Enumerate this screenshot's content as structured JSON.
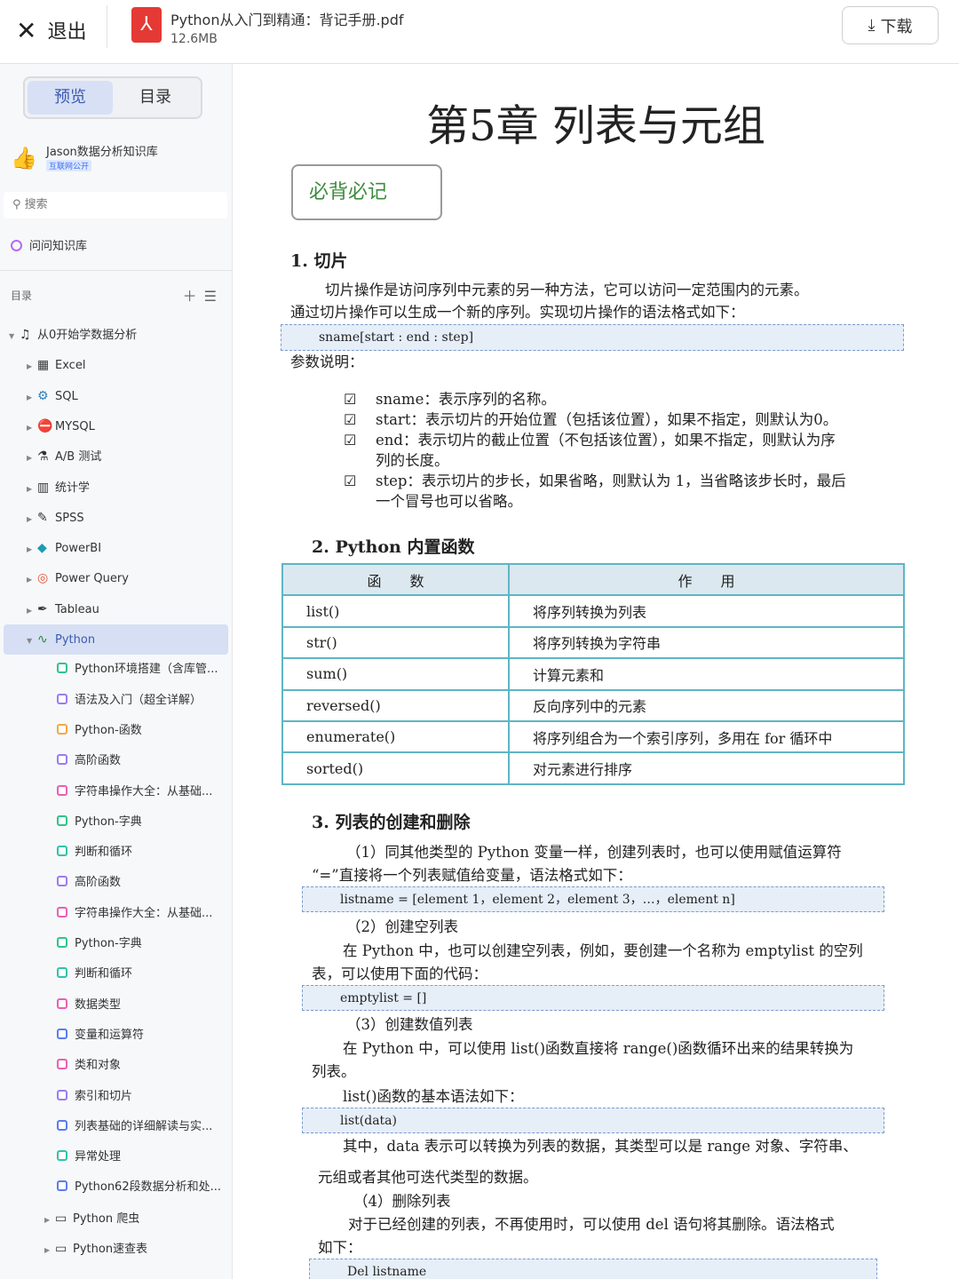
{
  "topbar": {
    "exit": "退出",
    "file_name": "Python从入门到精通：背记手册.pdf",
    "file_size": "12.6MB",
    "download": "下载"
  },
  "sidebar": {
    "tab_preview": "预览",
    "tab_toc": "目录",
    "kb_name": "Jason数据分析知识库",
    "kb_tag": "互联网公开",
    "search_placeholder": "搜索",
    "ask": "问问知识库",
    "toc_header": "目录",
    "items": [
      {
        "label": "从0开始学数据分析",
        "icon": "music-note-icon",
        "level": 0
      },
      {
        "label": "Excel",
        "icon": "spreadsheet-icon",
        "level": 1
      },
      {
        "label": "SQL",
        "icon": "gear-people-icon",
        "level": 1
      },
      {
        "label": "MYSQL",
        "icon": "no-entry-icon",
        "level": 1
      },
      {
        "label": "A/B 测试",
        "icon": "ab-icon",
        "level": 1
      },
      {
        "label": "统计学",
        "icon": "chart-icon",
        "level": 1
      },
      {
        "label": "SPSS",
        "icon": "syringe-icon",
        "level": 1
      },
      {
        "label": "PowerBI",
        "icon": "gem-icon",
        "level": 1
      },
      {
        "label": "Power Query",
        "icon": "target-icon",
        "level": 1
      },
      {
        "label": "Tableau",
        "icon": "pen-icon",
        "level": 1
      },
      {
        "label": "Python",
        "icon": "snake-icon",
        "level": 1
      },
      {
        "label": "Python环境搭建（含库管...",
        "color": "#2fc48a",
        "level": 2
      },
      {
        "label": "语法及入门（超全详解）",
        "color": "#9b7cf0",
        "level": 2
      },
      {
        "label": "Python-函数",
        "color": "#f5a742",
        "level": 2
      },
      {
        "label": "高阶函数",
        "color": "#9b7cf0",
        "level": 2
      },
      {
        "label": "字符串操作大全：从基础...",
        "color": "#ea5fb4",
        "level": 2
      },
      {
        "label": "Python-字典",
        "color": "#2fc48a",
        "level": 2
      },
      {
        "label": "判断和循环",
        "color": "#2fc4a8",
        "level": 2
      },
      {
        "label": "高阶函数",
        "color": "#9b7cf0",
        "level": 2
      },
      {
        "label": "字符串操作大全：从基础...",
        "color": "#ea5fb4",
        "level": 2
      },
      {
        "label": "Python-字典",
        "color": "#2fc48a",
        "level": 2
      },
      {
        "label": "判断和循环",
        "color": "#2fc4a8",
        "level": 2
      },
      {
        "label": "数据类型",
        "color": "#ea5fb4",
        "level": 2
      },
      {
        "label": "变量和运算符",
        "color": "#5a7cf0",
        "level": 2
      },
      {
        "label": "类和对象",
        "color": "#ea5fb4",
        "level": 2
      },
      {
        "label": "索引和切片",
        "color": "#9b7cf0",
        "level": 2
      },
      {
        "label": "列表基础的详细解读与实...",
        "color": "#5a7cf0",
        "level": 2
      },
      {
        "label": "异常处理",
        "color": "#2fc4a8",
        "level": 2
      },
      {
        "label": "Python62段数据分析和处...",
        "color": "#5a7cf0",
        "level": 2
      },
      {
        "label": "Python 爬虫",
        "icon": "folder-icon",
        "level": 2
      },
      {
        "label": "Python速查表",
        "icon": "folder-icon",
        "level": 2
      }
    ]
  },
  "doc": {
    "chapter_title": "第5章 列表与元组",
    "must_remember": "必背必记",
    "s1_title": "1.  切片",
    "s1_p1": "切片操作是访问序列中元素的另一种方法，它可以访问一定范围内的元素。",
    "s1_p2": "通过切片操作可以生成一个新的序列。实现切片操作的语法格式如下：",
    "s1_code": "sname[start : end : step]",
    "params_label": "参数说明：",
    "checks": [
      [
        "sname：表示序列的名称。"
      ],
      [
        "start：表示切片的开始位置（包括该位置），如果不指定，则默认为0。"
      ],
      [
        "end：表示切片的截止位置（不包括该位置），如果不指定，则默认为序",
        "列的长度。"
      ],
      [
        "step：表示切片的步长，如果省略，则默认为 1，当省略该步长时，最后",
        "一个冒号也可以省略。"
      ]
    ],
    "s2_title": "2. Python 内置函数",
    "table_head": [
      "函　　数",
      "作　　用"
    ],
    "table_rows": [
      [
        "list()",
        "将序列转换为列表"
      ],
      [
        "str()",
        "将序列转换为字符串"
      ],
      [
        "sum()",
        "计算元素和"
      ],
      [
        "reversed()",
        "反向序列中的元素"
      ],
      [
        "enumerate()",
        "将序列组合为一个索引序列，多用在 for 循环中"
      ],
      [
        "sorted()",
        "对元素进行排序"
      ]
    ],
    "s3_title": "3.  列表的创建和删除",
    "s3_p1": "（1）同其他类型的 Python 变量一样，创建列表时，也可以使用赋值运算符",
    "s3_p2": "“=”直接将一个列表赋值给变量，语法格式如下：",
    "s3_code1": "listname = [element 1，element 2，element 3，…，element n]",
    "s3_p3": "（2）创建空列表",
    "s3_p4": "在 Python 中，也可以创建空列表，例如，要创建一个名称为 emptylist 的空列",
    "s3_p5": "表，可以使用下面的代码：",
    "s3_code2": "emptylist = []",
    "s3_p6": "（3）创建数值列表",
    "s3_p7": "在 Python 中，可以使用 list()函数直接将 range()函数循环出来的结果转换为",
    "s3_p8": "列表。",
    "s3_p9": "list()函数的基本语法如下：",
    "s3_code3": "list(data)",
    "s3_p10": "其中，data 表示可以转换为列表的数据，其类型可以是 range 对象、字符串、",
    "s3_p11": "元组或者其他可迭代类型的数据。",
    "s3_p12": "（4）删除列表",
    "s3_p13": "对于已经创建的列表，不再使用时，可以使用 del 语句将其删除。语法格式",
    "s3_p14": "如下：",
    "s3_code4": "Del listname"
  }
}
